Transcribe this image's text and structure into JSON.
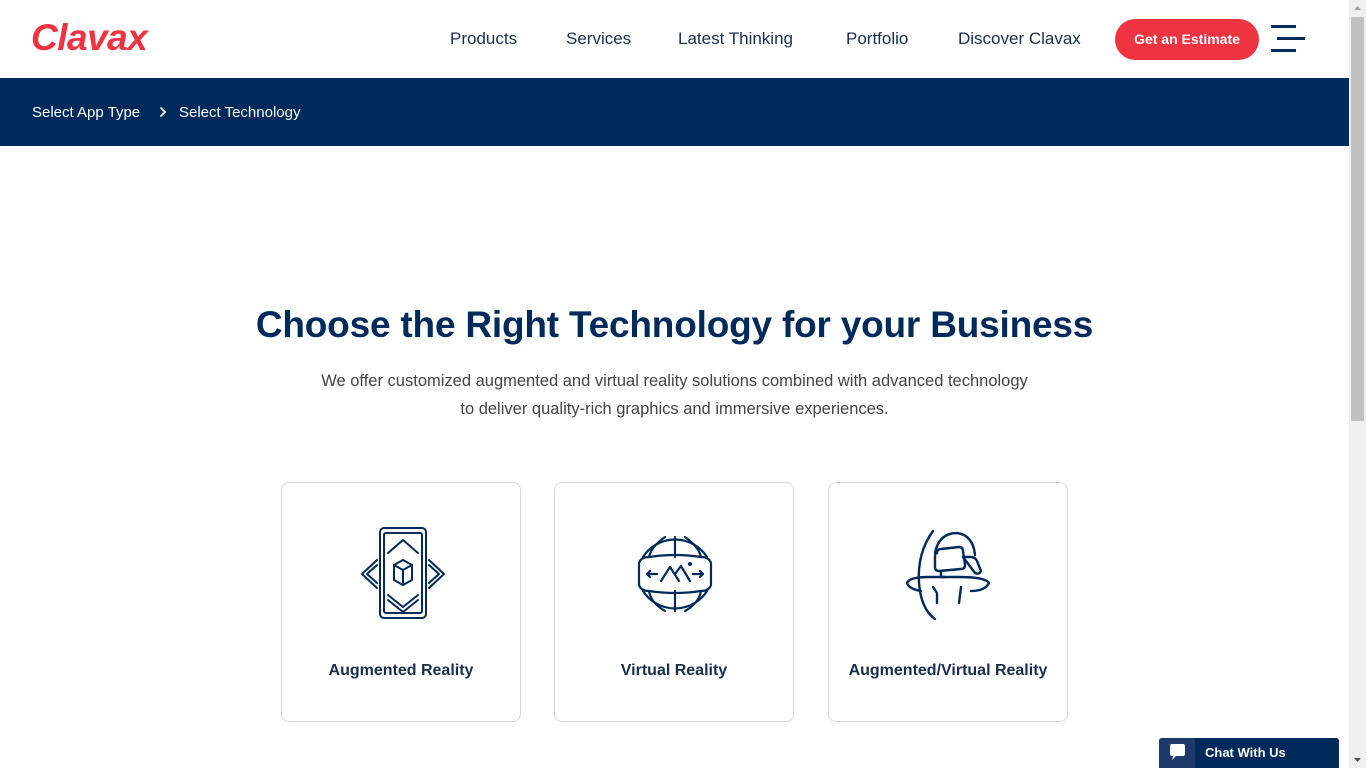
{
  "header": {
    "logo": "Clavax",
    "nav": [
      {
        "label": "Products"
      },
      {
        "label": "Services"
      },
      {
        "label": "Latest Thinking"
      },
      {
        "label": "Portfolio"
      },
      {
        "label": "Discover Clavax"
      }
    ],
    "cta_label": "Get an Estimate",
    "menu_icon": "hamburger-menu-icon"
  },
  "breadcrumb": {
    "items": [
      {
        "label": "Select App Type"
      },
      {
        "label": "Select Technology"
      }
    ],
    "separator_icon": "chevron-right-icon"
  },
  "main": {
    "title": "Choose the Right Technology for your Business",
    "subtitle_line1": "We offer customized augmented and virtual reality solutions combined with advanced technology",
    "subtitle_line2": "to deliver quality-rich graphics and immersive experiences.",
    "cards": [
      {
        "label": "Augmented Reality",
        "icon": "ar-phone-cube-icon"
      },
      {
        "label": "Virtual Reality",
        "icon": "vr-globe-panorama-icon"
      },
      {
        "label": "Augmented/Virtual Reality",
        "icon": "vr-headset-person-icon"
      }
    ]
  },
  "chat": {
    "label": "Chat With Us",
    "icon": "chat-bubble-icon"
  },
  "colors": {
    "brand_red": "#ef3340",
    "navy": "#002a5c",
    "text_gray": "#444444"
  }
}
